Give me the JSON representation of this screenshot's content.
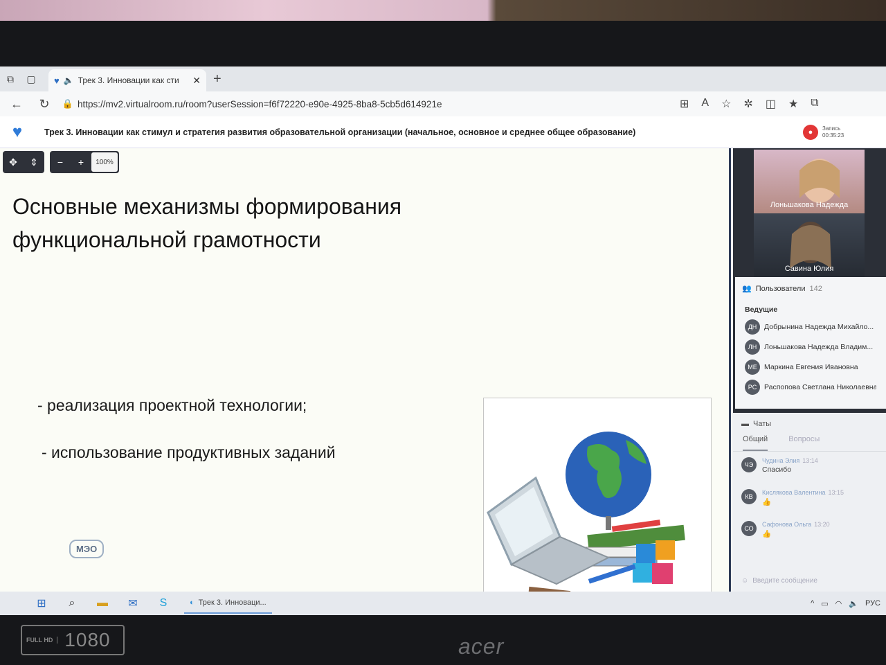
{
  "browser": {
    "tab_title": "Трек 3. Инновации как сти",
    "url": "https://mv2.virtualroom.ru/room?userSession=f6f72220-e90e-4925-8ba8-5cb5d614921e"
  },
  "app": {
    "title": "Трек 3. Инновации как стимул и стратегия развития образовательной организации (начальное, основное и среднее общее образование)",
    "record_label": "Запись",
    "record_time": "00:35:23"
  },
  "toolbar": {
    "zoom_out": "−",
    "zoom_in": "+",
    "zoom_level": "100%"
  },
  "slide": {
    "title_line1": "Основные механизмы формирования",
    "title_line2": "функциональной грамотности",
    "bullets": [
      "- реализация проектной технологии;",
      "- использование продуктивных заданий"
    ],
    "logo_text": "МЭО"
  },
  "videos": [
    {
      "name": "Лоньшакова Надежда"
    },
    {
      "name": "Савина Юлия"
    }
  ],
  "users": {
    "header": "Пользователи",
    "count": "142",
    "group_title": "Ведущие",
    "list": [
      {
        "initials": "ДН",
        "name": "Добрынина Надежда Михайло..."
      },
      {
        "initials": "ЛН",
        "name": "Лоньшакова Надежда Владим..."
      },
      {
        "initials": "МЕ",
        "name": "Маркина Евгения Ивановна"
      },
      {
        "initials": "РС",
        "name": "Распопова Светлана Николаевна"
      }
    ]
  },
  "chat": {
    "header": "Чаты",
    "tabs": [
      "Общий",
      "Вопросы"
    ],
    "messages": [
      {
        "initials": "ЧЭ",
        "author": "Чудина Элия",
        "time": "13:14",
        "text": "Спасибо"
      },
      {
        "initials": "КВ",
        "author": "Кислякова Валентина",
        "time": "13:15",
        "text": "👍"
      },
      {
        "initials": "СО",
        "author": "Сафонова Ольга",
        "time": "13:20",
        "text": "👍"
      }
    ],
    "input_placeholder": "Введите сообщение"
  },
  "taskbar": {
    "app_label": "Трек 3. Инноваци...",
    "lang": "РУС"
  },
  "bezel": {
    "badge_small": "FULL HD",
    "badge_big": "1080",
    "brand": "acer"
  }
}
